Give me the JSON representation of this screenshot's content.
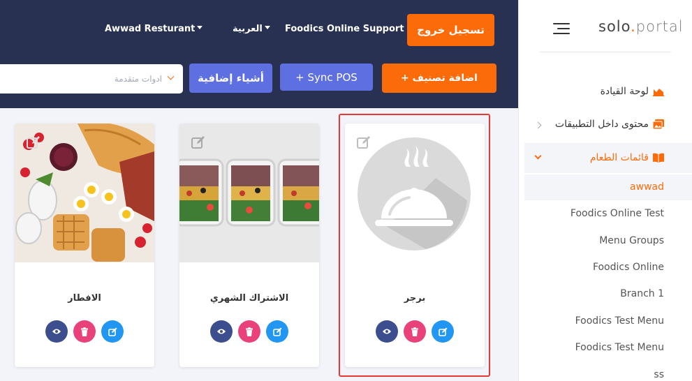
{
  "navbar": {
    "restaurant": "Awwad Resturant",
    "language": "العربية",
    "support": "Foodics Online Support",
    "logout": "تسجيل خروج"
  },
  "toolbar": {
    "add_category": "+ اضافة تصنيف",
    "sync_pos": "+ Sync POS",
    "extras": "أشياء إضافية",
    "advanced_tools": "ادوات متقدمة"
  },
  "cards": [
    {
      "title": "برجر",
      "image": "cloche-placeholder",
      "highlighted": true
    },
    {
      "title": "الاشتراك الشهري",
      "image": "meal-prep-containers-photo",
      "highlighted": false
    },
    {
      "title": "الافطار",
      "image": "breakfast-spread-photo",
      "highlighted": false
    }
  ],
  "sidebar": {
    "brand_solo": "solo",
    "brand_dot": ".",
    "brand_portal": "portal",
    "items": [
      {
        "label": "لوحة القيادة",
        "icon": "dashboard-icon"
      },
      {
        "label": "محتوى داخل التطبيقات",
        "icon": "images-icon"
      },
      {
        "label": "قائمات الطعام",
        "icon": "book-icon"
      }
    ],
    "submenu": [
      "awwad",
      "Foodics Online Test",
      "Menu Groups",
      "Foodics Online",
      "Branch 1",
      "Foodics Test Menu",
      "Foodics Test Menu",
      "ss"
    ]
  },
  "colors": {
    "navbar": "#283152",
    "accent": "#fc6b0a",
    "secondary": "#5d6fe1",
    "view": "#3d4e8f",
    "delete": "#e9417a",
    "edit": "#2196f3",
    "highlight": "#e53935"
  }
}
